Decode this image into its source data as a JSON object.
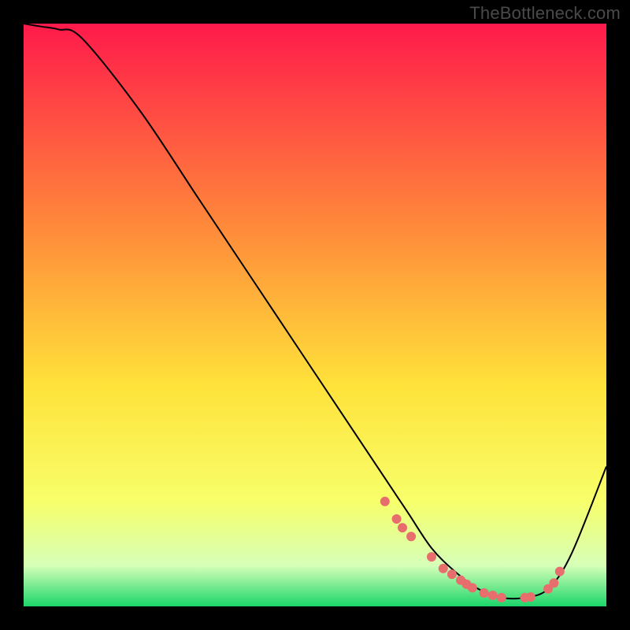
{
  "watermark": "TheBottleneck.com",
  "colors": {
    "frame": "#000000",
    "line": "#000000",
    "marker": "#e86d6d",
    "grad_top": "#ff1a4b",
    "grad_mid_upper": "#ff8a3a",
    "grad_mid": "#ffe23a",
    "grad_lower": "#f7ff6a",
    "grad_light": "#d6ffb8",
    "grad_bottom": "#1bd66a"
  },
  "chart_data": {
    "type": "line",
    "title": "",
    "xlabel": "",
    "ylabel": "",
    "xlim": [
      0,
      100
    ],
    "ylim": [
      0,
      100
    ],
    "series": [
      {
        "name": "curve",
        "x": [
          0,
          3,
          6,
          10,
          20,
          30,
          40,
          50,
          58,
          62,
          66,
          70,
          74,
          78,
          82,
          86,
          90,
          94,
          100
        ],
        "y": [
          100,
          99.5,
          99,
          97.5,
          85,
          70,
          55,
          40,
          28,
          22,
          16,
          10,
          6,
          3,
          1.5,
          1.5,
          3,
          9,
          24
        ]
      }
    ],
    "markers": {
      "name": "points",
      "x": [
        62,
        64,
        65,
        66.5,
        70,
        72,
        73.5,
        75,
        76,
        77,
        79,
        80.5,
        82,
        86,
        87,
        90,
        91,
        92
      ],
      "y": [
        18,
        15,
        13.5,
        12,
        8.5,
        6.5,
        5.5,
        4.5,
        3.8,
        3.2,
        2.3,
        1.9,
        1.5,
        1.5,
        1.6,
        3.0,
        4.0,
        6.0
      ]
    }
  }
}
